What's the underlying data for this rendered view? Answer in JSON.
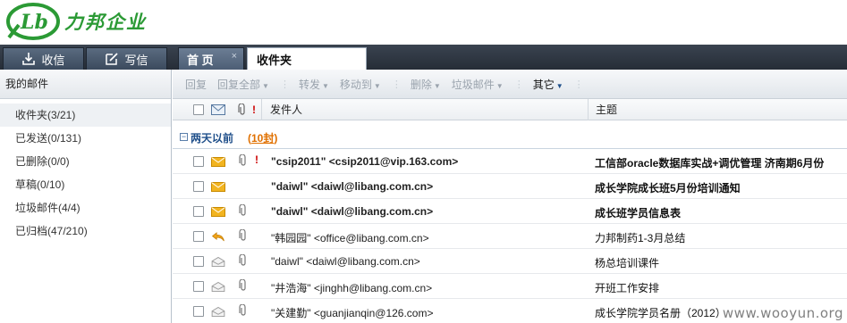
{
  "brand": {
    "logo_mark": "Lb",
    "name": "力邦企业"
  },
  "top_buttons": {
    "receive": "收信",
    "compose": "写信"
  },
  "tabs": {
    "home": "首 页",
    "home_close": "×",
    "inbox": "收件夹"
  },
  "sidebar": {
    "heading": "我的邮件",
    "folders": [
      {
        "label": "收件夹(3/21)",
        "active": true
      },
      {
        "label": "已发送(0/131)"
      },
      {
        "label": "已删除(0/0)"
      },
      {
        "label": "草稿(0/10)"
      },
      {
        "label": "垃圾邮件(4/4)"
      },
      {
        "label": "已归档(47/210)"
      }
    ]
  },
  "toolbar": {
    "reply": "回复",
    "reply_all": "回复全部",
    "forward": "转发",
    "move_to": "移动到",
    "delete": "删除",
    "spam": "垃圾邮件",
    "other": "其它"
  },
  "list_header": {
    "sender": "发件人",
    "subject": "主题"
  },
  "group": {
    "label": "两天以前",
    "count_open": "(",
    "count": "10封",
    "count_close": ")"
  },
  "messages": [
    {
      "from_name": "\"csip2011\"",
      "from_email": "<csip2011@vip.163.com>",
      "subject": "工信部oracle数据库实战+调优管理 济南期6月份",
      "unread": true,
      "icon": "envelope-closed-icon",
      "attachment": true,
      "important": true
    },
    {
      "from_name": "\"daiwl\"",
      "from_email": "<daiwl@libang.com.cn>",
      "subject": "成长学院成长班5月份培训通知",
      "unread": true,
      "icon": "envelope-closed-icon",
      "attachment": false
    },
    {
      "from_name": "\"daiwl\"",
      "from_email": "<daiwl@libang.com.cn>",
      "subject": "成长班学员信息表",
      "unread": true,
      "icon": "envelope-closed-icon",
      "attachment": true
    },
    {
      "from_name": "\"韩园园\"",
      "from_email": "<office@libang.com.cn>",
      "subject": "力邦制药1-3月总结",
      "unread": false,
      "icon": "reply-arrow-icon",
      "attachment": true
    },
    {
      "from_name": "\"daiwl\"",
      "from_email": "<daiwl@libang.com.cn>",
      "subject": "杨总培训课件",
      "unread": false,
      "icon": "envelope-open-icon",
      "attachment": true
    },
    {
      "from_name": "\"井浩海\"",
      "from_email": "<jinghh@libang.com.cn>",
      "subject": "开班工作安排",
      "unread": false,
      "icon": "envelope-open-icon",
      "attachment": true
    },
    {
      "from_name": "\"关建勤\"",
      "from_email": "<guanjianqin@126.com>",
      "subject": "成长学院学员名册（2012）",
      "unread": false,
      "icon": "envelope-open-icon",
      "attachment": true
    }
  ],
  "watermark": "www.wooyun.org",
  "colors": {
    "brand_green": "#2b9a35",
    "tab_dark": "#262d37",
    "group_blue": "#1f4f8a",
    "count_orange": "#e07000",
    "unread_envelope": "#f2b420"
  }
}
